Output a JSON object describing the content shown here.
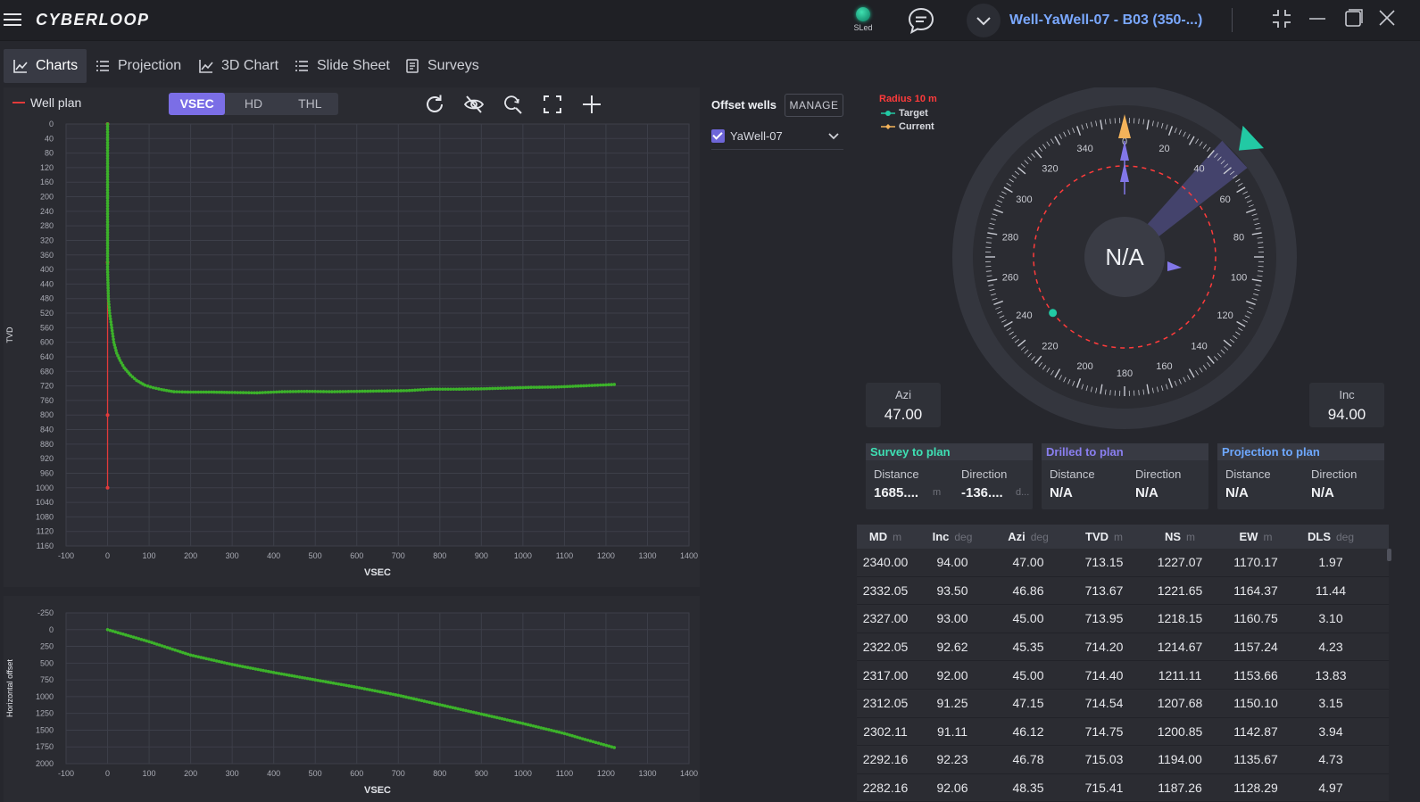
{
  "app": {
    "logo": "CYBERLOOP",
    "sled_label": "SLed",
    "well_name": "Well-YaWell-07 - B03 (350-...)"
  },
  "tabs": [
    {
      "label": "Charts",
      "icon": "line-chart-icon",
      "active": true
    },
    {
      "label": "Projection",
      "icon": "list-icon"
    },
    {
      "label": "3D Chart",
      "icon": "line-chart-icon"
    },
    {
      "label": "Slide Sheet",
      "icon": "list-icon"
    },
    {
      "label": "Surveys",
      "icon": "document-icon"
    }
  ],
  "chart_panel": {
    "legend_label": "Well plan",
    "view_modes": [
      "VSEC",
      "HD",
      "THL"
    ],
    "active_view": "VSEC",
    "tools": [
      "refresh-icon",
      "hide-icon",
      "zoom-reset-icon",
      "fullscreen-icon",
      "add-icon"
    ]
  },
  "colors": {
    "accent": "#7b6ee6",
    "plan_line": "#e23a3a",
    "survey_points": "#3cb22a",
    "target": "#22c9a4",
    "current": "#f4b35a",
    "radius": "#ff3b3b"
  },
  "chart_data": [
    {
      "type": "scatter",
      "title": "",
      "xlabel": "VSEC",
      "ylabel": "TVD",
      "xlim": [
        -100,
        1400
      ],
      "ylim": [
        1160,
        0
      ],
      "x_ticks": [
        "-100",
        "0",
        "100",
        "200",
        "300",
        "400",
        "500",
        "600",
        "700",
        "800",
        "900",
        "1000",
        "1100",
        "1200",
        "1300",
        "1400"
      ],
      "y_ticks": [
        "0",
        "40",
        "80",
        "120",
        "160",
        "200",
        "240",
        "280",
        "320",
        "360",
        "400",
        "440",
        "480",
        "520",
        "560",
        "600",
        "640",
        "680",
        "720",
        "760",
        "800",
        "840",
        "880",
        "920",
        "960",
        "1000",
        "1040",
        "1080",
        "1120",
        "1160"
      ],
      "grid": true,
      "series": [
        {
          "name": "Well plan",
          "kind": "line",
          "x": [
            0,
            0,
            0,
            0
          ],
          "y": [
            0,
            380,
            800,
            1000
          ]
        },
        {
          "name": "",
          "kind": "points",
          "x": [
            0,
            0,
            0,
            0,
            0,
            0,
            2,
            5,
            10,
            15,
            22,
            30,
            40,
            55,
            70,
            90,
            110,
            130,
            160,
            200,
            250,
            300,
            360,
            420,
            480,
            540,
            600,
            660,
            720,
            780,
            840,
            900,
            960,
            1020,
            1080,
            1140,
            1180,
            1220
          ],
          "y": [
            0,
            80,
            160,
            240,
            320,
            400,
            480,
            520,
            560,
            600,
            630,
            650,
            670,
            690,
            705,
            718,
            725,
            730,
            736,
            737,
            737,
            738,
            739,
            736,
            735,
            736,
            735,
            734,
            733,
            729,
            729,
            728,
            726,
            724,
            723,
            720,
            718,
            716
          ]
        }
      ]
    },
    {
      "type": "scatter",
      "title": "",
      "xlabel": "VSEC",
      "ylabel": "Horizontal offset",
      "xlim": [
        -100,
        1400
      ],
      "ylim": [
        2000,
        -250
      ],
      "x_ticks": [
        "-100",
        "0",
        "100",
        "200",
        "300",
        "400",
        "500",
        "600",
        "700",
        "800",
        "900",
        "1000",
        "1100",
        "1200",
        "1300",
        "1400"
      ],
      "y_ticks": [
        "-250",
        "0",
        "250",
        "500",
        "750",
        "1000",
        "1250",
        "1500",
        "1750",
        "2000"
      ],
      "grid": true,
      "series": [
        {
          "name": "",
          "kind": "points",
          "x": [
            0,
            50,
            100,
            150,
            200,
            250,
            300,
            400,
            500,
            600,
            700,
            800,
            900,
            1000,
            1100,
            1150,
            1220
          ],
          "y": [
            0,
            90,
            180,
            280,
            380,
            450,
            520,
            640,
            750,
            860,
            980,
            1120,
            1260,
            1400,
            1550,
            1640,
            1760
          ]
        }
      ]
    }
  ],
  "offset_wells": {
    "title": "Offset wells",
    "manage_label": "MANAGE",
    "items": [
      {
        "name": "YaWell-07",
        "checked": true
      }
    ]
  },
  "compass": {
    "radius_label": "Radius 10 m",
    "target_label": "Target",
    "current_label": "Current",
    "center_value": "N/A",
    "dial_labels": [
      "0",
      "20",
      "40",
      "60",
      "80",
      "100",
      "120",
      "140",
      "160",
      "180",
      "200",
      "220",
      "240",
      "260",
      "280",
      "300",
      "320",
      "340"
    ],
    "target_azimuth": 47,
    "azi_label": "Azi",
    "azi_value": "47.00",
    "inc_label": "Inc",
    "inc_value": "94.00"
  },
  "stats": [
    {
      "title": "Survey to plan",
      "title_color": "#3ee0b4",
      "distance_label": "Distance",
      "direction_label": "Direction",
      "distance": "1685....",
      "distance_unit": "m",
      "direction": "-136....",
      "direction_unit": "d..."
    },
    {
      "title": "Drilled to plan",
      "title_color": "#8a7ff0",
      "distance_label": "Distance",
      "direction_label": "Direction",
      "distance": "N/A",
      "direction": "N/A"
    },
    {
      "title": "Projection to plan",
      "title_color": "#6ea8ff",
      "distance_label": "Distance",
      "direction_label": "Direction",
      "distance": "N/A",
      "direction": "N/A"
    }
  ],
  "survey_table": {
    "columns": [
      {
        "label": "MD",
        "unit": "m"
      },
      {
        "label": "Inc",
        "unit": "deg"
      },
      {
        "label": "Azi",
        "unit": "deg"
      },
      {
        "label": "TVD",
        "unit": "m"
      },
      {
        "label": "NS",
        "unit": "m"
      },
      {
        "label": "EW",
        "unit": "m"
      },
      {
        "label": "DLS",
        "unit": "deg"
      }
    ],
    "rows": [
      [
        "2340.00",
        "94.00",
        "47.00",
        "713.15",
        "1227.07",
        "1170.17",
        "1.97"
      ],
      [
        "2332.05",
        "93.50",
        "46.86",
        "713.67",
        "1221.65",
        "1164.37",
        "11.44"
      ],
      [
        "2327.00",
        "93.00",
        "45.00",
        "713.95",
        "1218.15",
        "1160.75",
        "3.10"
      ],
      [
        "2322.05",
        "92.62",
        "45.35",
        "714.20",
        "1214.67",
        "1157.24",
        "4.23"
      ],
      [
        "2317.00",
        "92.00",
        "45.00",
        "714.40",
        "1211.11",
        "1153.66",
        "13.83"
      ],
      [
        "2312.05",
        "91.25",
        "47.15",
        "714.54",
        "1207.68",
        "1150.10",
        "3.15"
      ],
      [
        "2302.11",
        "91.11",
        "46.12",
        "714.75",
        "1200.85",
        "1142.87",
        "3.94"
      ],
      [
        "2292.16",
        "92.23",
        "46.78",
        "715.03",
        "1194.00",
        "1135.67",
        "4.73"
      ],
      [
        "2282.16",
        "92.06",
        "48.35",
        "715.41",
        "1187.26",
        "1128.29",
        "4.97"
      ]
    ]
  }
}
